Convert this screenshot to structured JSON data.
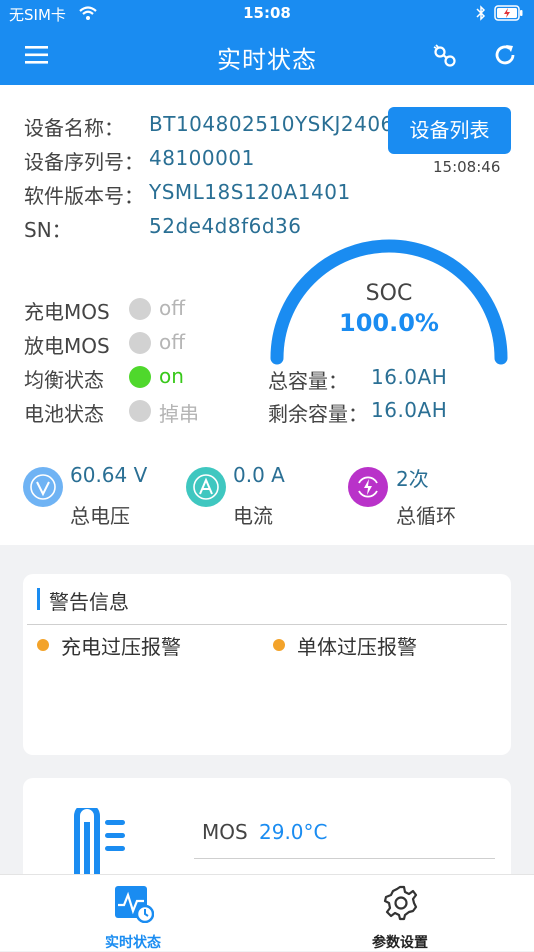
{
  "status_bar": {
    "carrier": "无SIM卡",
    "time": "15:08"
  },
  "nav": {
    "title": "实时状态"
  },
  "device": {
    "name_label": "设备名称：",
    "name_value": "BT104802510YSKJ2406",
    "serial_label": "设备序列号：",
    "serial_value": "48100001",
    "version_label": "软件版本号：",
    "version_value": "YSML18S120A1401",
    "sn_label": "SN：",
    "sn_value": "52de4d8f6d36",
    "list_button": "设备列表",
    "timestamp": "15:08:46"
  },
  "switches": [
    {
      "label": "充电MOS",
      "state": "off",
      "active": false
    },
    {
      "label": "放电MOS",
      "state": "off",
      "active": false
    },
    {
      "label": "均衡状态",
      "state": "on",
      "active": true
    },
    {
      "label": "电池状态",
      "state": "掉串",
      "active": false
    }
  ],
  "soc": {
    "label": "SOC",
    "value": "100.0%",
    "fraction": 1.0
  },
  "capacity": {
    "total_label": "总容量：",
    "total_value": "16.0AH",
    "remaining_label": "剩余容量：",
    "remaining_value": "16.0AH"
  },
  "metrics": [
    {
      "value": "60.64 V",
      "label": "总电压",
      "color": "#6fb3f4",
      "icon": "voltage-icon"
    },
    {
      "value": "0.0 A",
      "label": "电流",
      "color": "#3fc7c0",
      "icon": "current-icon"
    },
    {
      "value": "2次",
      "label": "总循环",
      "color": "#b932c9",
      "icon": "cycle-icon"
    }
  ],
  "warnings": {
    "title": "警告信息",
    "items": [
      "充电过压报警",
      "单体过压报警"
    ],
    "dot_color": "#f3a32a"
  },
  "temperature": {
    "mos_label": "MOS",
    "mos_value": "29.0°C"
  },
  "tabs": [
    {
      "label": "实时状态",
      "active": true
    },
    {
      "label": "参数设置",
      "active": false
    }
  ],
  "colors": {
    "primary": "#1a8cf1",
    "value_text": "#2a6f94"
  }
}
